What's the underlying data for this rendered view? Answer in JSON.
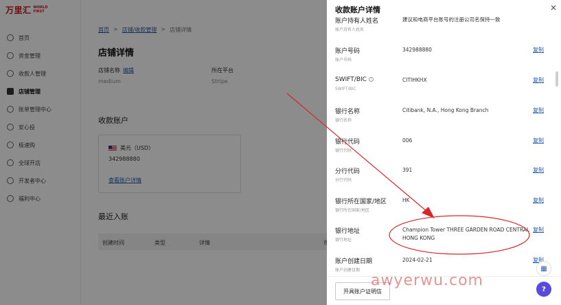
{
  "logo": {
    "cn": "万里汇",
    "en_line1": "WORLD",
    "en_line2": "FIRST"
  },
  "sidebar": {
    "items": [
      {
        "label": "首页"
      },
      {
        "label": "资金管理"
      },
      {
        "label": "收款人管理"
      },
      {
        "label": "店铺管理",
        "active": true
      },
      {
        "label": "账单管理中心"
      },
      {
        "label": "安心投"
      },
      {
        "label": "极速购"
      },
      {
        "label": "全球开店"
      },
      {
        "label": "开发者中心"
      },
      {
        "label": "福利中心"
      }
    ]
  },
  "main": {
    "breadcrumb": {
      "home": "首页",
      "sep1": ">",
      "parent": "店铺/收款管理",
      "sep2": ">",
      "current": "店铺详情"
    },
    "title": "店铺详情",
    "store_name_label": "店铺名称",
    "edit_label": "编辑",
    "store_name_value": "medium",
    "platform_label": "所在平台",
    "platform_value": "Stripe",
    "receiving_title": "收款账户",
    "currency_label": "美元（USD）",
    "account_number": "342988880",
    "view_details": "查看账户详情",
    "recent_title": "最近入账",
    "table_headers": [
      "创建时间",
      "类型",
      "详情",
      "币"
    ]
  },
  "drawer": {
    "title": "收款账户详情",
    "close": "×",
    "copy_label": "复制",
    "rows": [
      {
        "label": "账户持有人姓名",
        "sub": "账户持有人姓名",
        "value": "建议和电商平台账号的注册公司名保持一致",
        "copy": false
      },
      {
        "label": "账户号码",
        "sub": "账户号码",
        "value": "342988880",
        "copy": true
      },
      {
        "label": "SWIFT/BIC",
        "sub": "SWIFT/BIC",
        "value": "CITIHKHX",
        "copy": true,
        "info": "i"
      },
      {
        "label": "银行名称",
        "sub": "银行名称",
        "value": "Citibank, N.A., Hong Kong Branch",
        "copy": true
      },
      {
        "label": "银行代码",
        "sub": "银行代码",
        "value": "006",
        "copy": true
      },
      {
        "label": "分行代码",
        "sub": "分行代码",
        "value": "391",
        "copy": true
      },
      {
        "label": "银行所在国家/地区",
        "sub": "银行所在国家/地区",
        "value": "HK",
        "copy": true
      },
      {
        "label": "银行地址",
        "sub": "银行地址",
        "value": "Champion Tower THREE GARDEN ROAD CENTRAL HONG KONG",
        "copy": true
      },
      {
        "label": "账户创建日期",
        "sub": "账户创建日期",
        "value": "2024-02-21",
        "copy": true
      }
    ],
    "footer_button": "开具账户证明信"
  },
  "floating": {
    "grid_icon": "grid-icon",
    "help": "?"
  },
  "watermark": "awyerwu.com",
  "colors": {
    "brand": "#c8161d",
    "link": "#2b5ea7",
    "annotation": "#d9262b",
    "help": "#5b4bdc"
  }
}
